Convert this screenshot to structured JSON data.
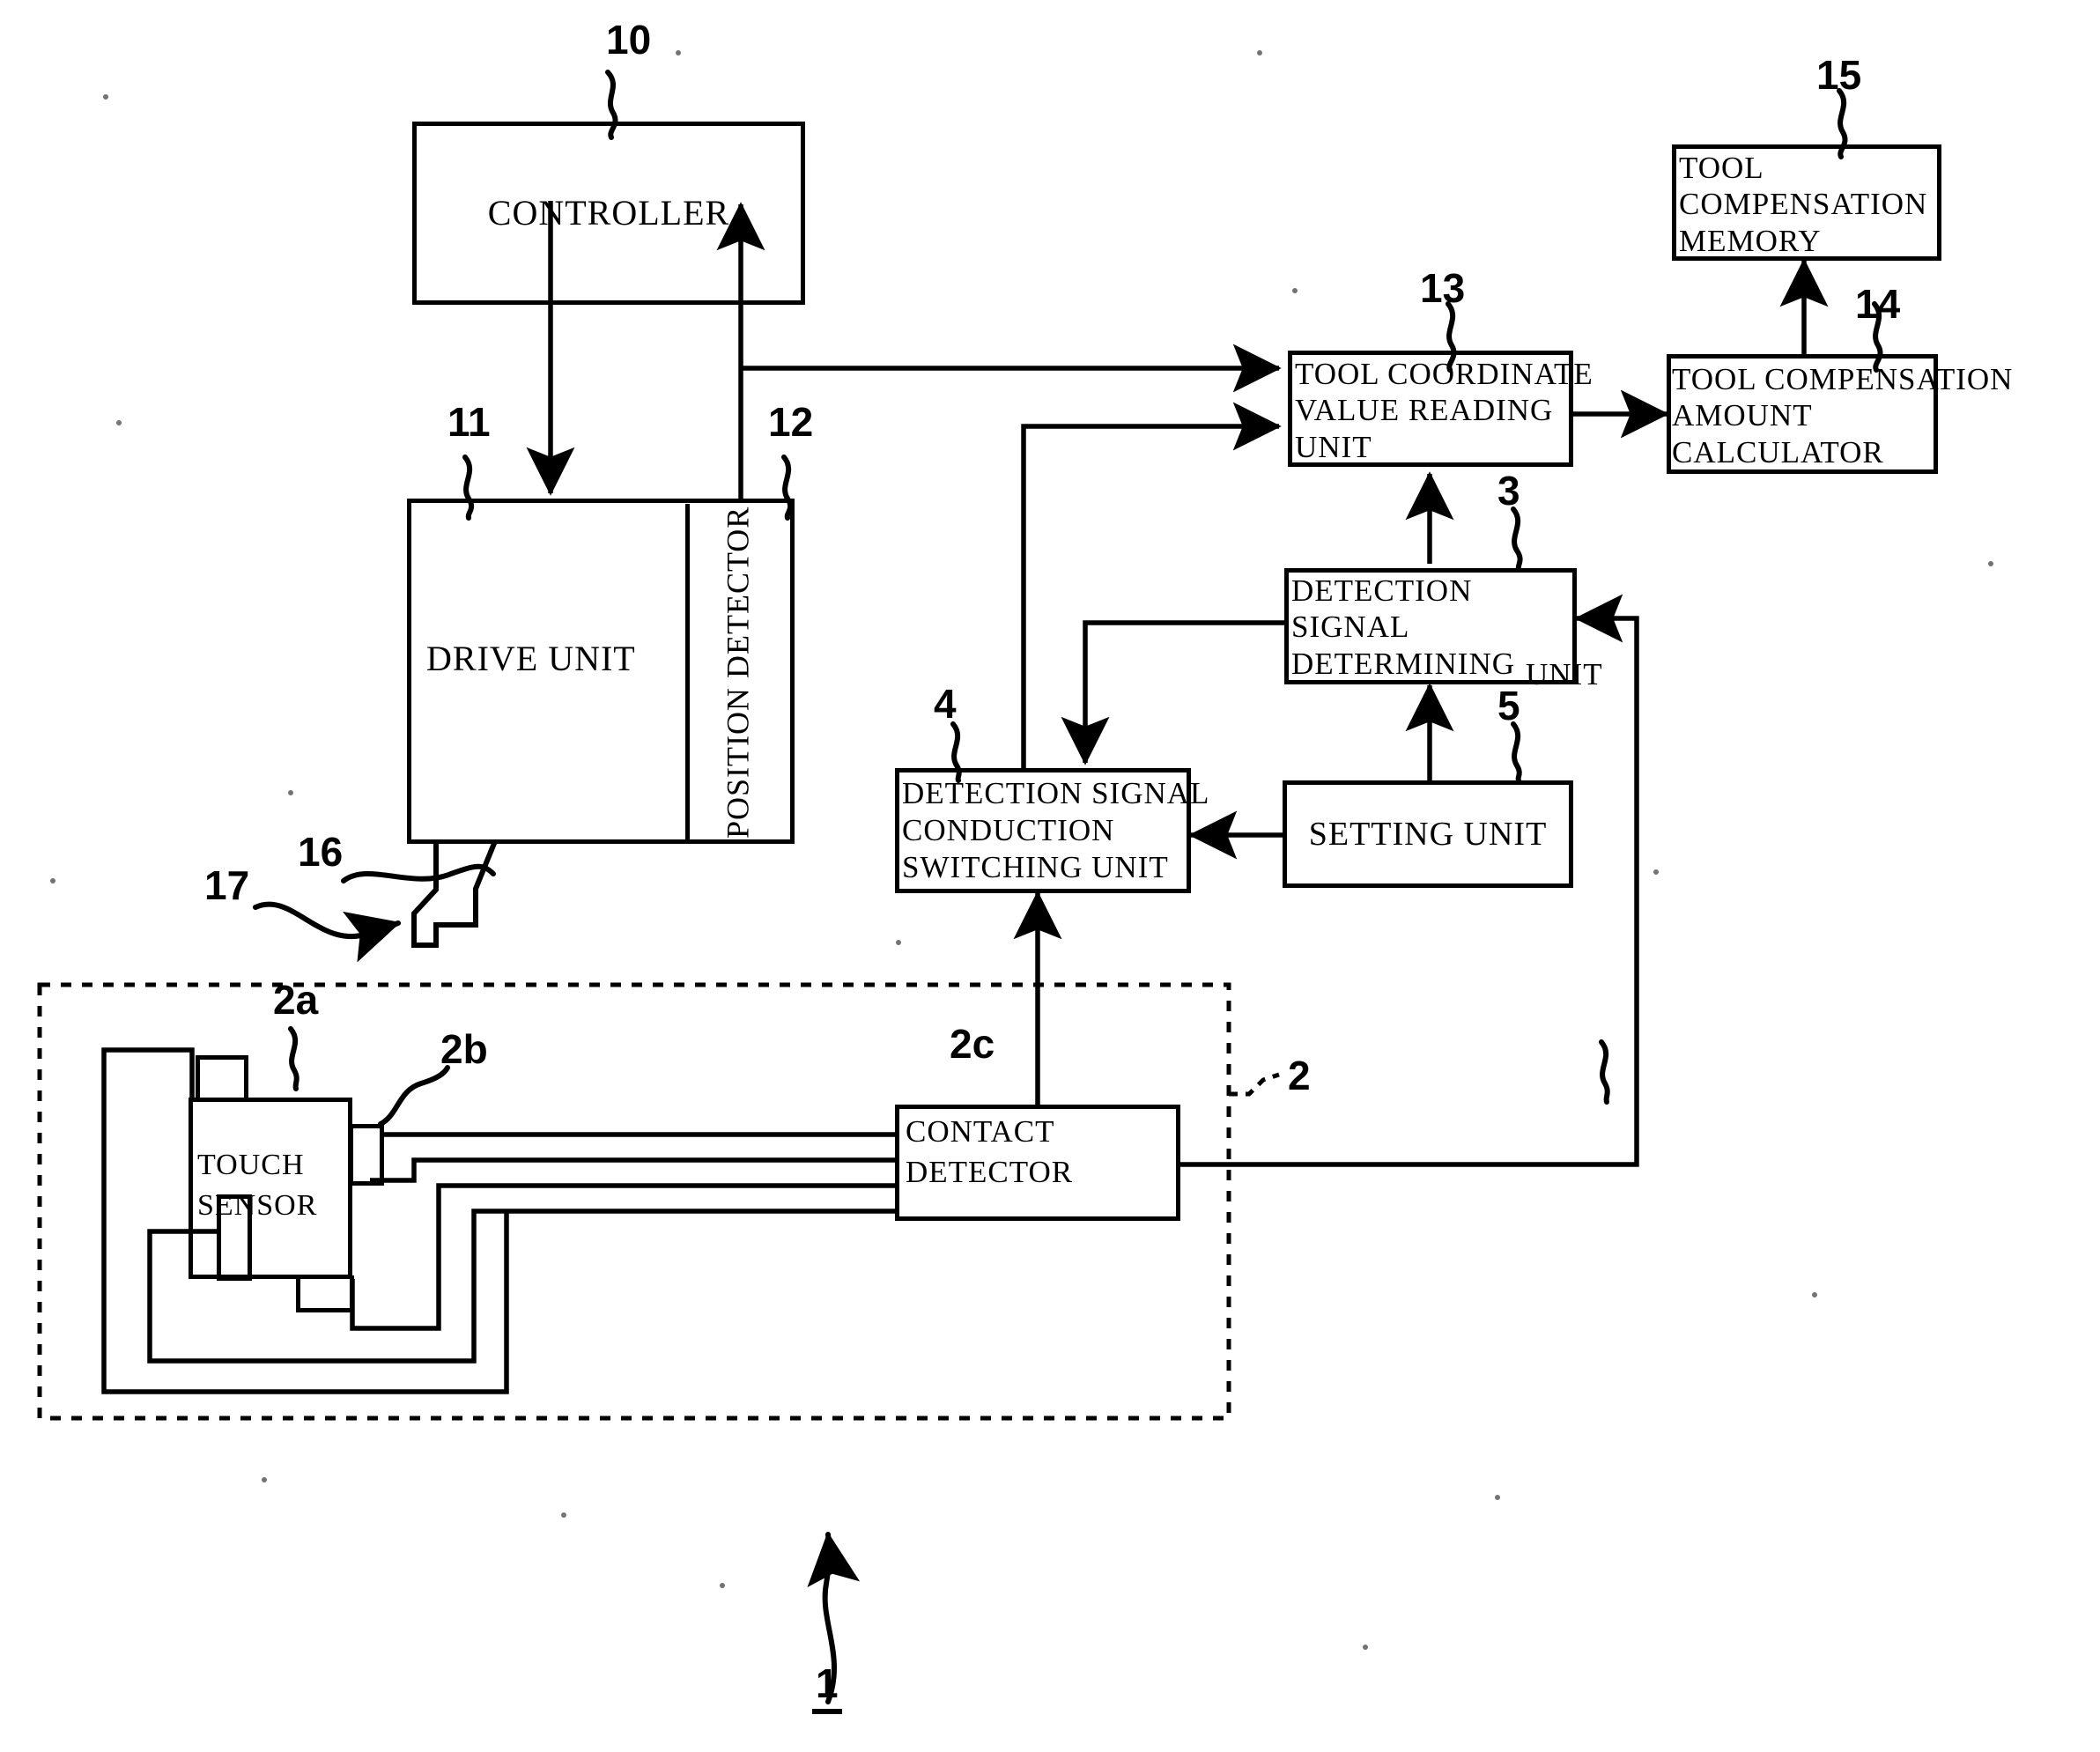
{
  "figure": {
    "kind": "patent-block-diagram",
    "overall_ref": "1"
  },
  "blocks": [
    {
      "id": "controller",
      "ref": "10",
      "label": "CONTROLLER"
    },
    {
      "id": "drive-unit",
      "ref": "11",
      "label": "DRIVE UNIT"
    },
    {
      "id": "position-detector",
      "ref": "12",
      "label": "POSITION DETECTOR"
    },
    {
      "id": "tool-coordinate-value-reading-unit",
      "ref": "13",
      "label": "TOOL COORDINATE\nVALUE READING\nUNIT"
    },
    {
      "id": "tool-compensation-amount-calculator",
      "ref": "14",
      "label": "TOOL COMPENSATION\nAMOUNT\nCALCULATOR"
    },
    {
      "id": "tool-compensation-memory",
      "ref": "15",
      "label": "TOOL\nCOMPENSATION\nMEMORY"
    },
    {
      "id": "detection-signal-determining-unit",
      "ref": "3",
      "label": "DETECTION\nSIGNAL\nDETERMINING",
      "label_overflow": "UNIT"
    },
    {
      "id": "detection-signal-conduction-switching-unit",
      "ref": "4",
      "label": "DETECTION SIGNAL\nCONDUCTION\nSWITCHING UNIT"
    },
    {
      "id": "setting-unit",
      "ref": "5",
      "label": "SETTING UNIT"
    },
    {
      "id": "touch-sensor",
      "ref": "2a",
      "label": "TOUCH\nSENSOR"
    },
    {
      "id": "contact-element",
      "ref": "2b",
      "label": ""
    },
    {
      "id": "contact-detector",
      "ref": "2c",
      "label": "CONTACT\nDETECTOR"
    }
  ],
  "groups": [
    {
      "id": "touch-sensor-assembly",
      "ref": "2",
      "style": "dashed"
    }
  ],
  "tool": {
    "holder_ref": "16",
    "tip_ref": "17"
  },
  "refs": {
    "r1": "1",
    "r2": "2",
    "r2a": "2a",
    "r2b": "2b",
    "r2c": "2c",
    "r3": "3",
    "r4": "4",
    "r5": "5",
    "r10": "10",
    "r11": "11",
    "r12": "12",
    "r13": "13",
    "r14": "14",
    "r15": "15",
    "r16": "16",
    "r17": "17"
  },
  "colors": {
    "ink": "#000000",
    "paper": "#ffffff"
  }
}
